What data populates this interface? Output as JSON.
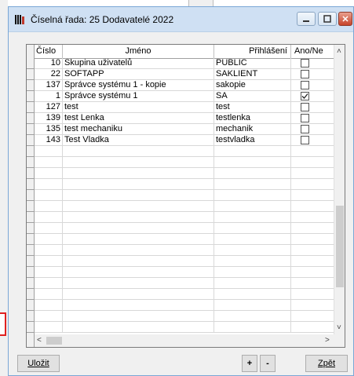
{
  "window": {
    "title": "Číselná řada: 25 Dodavatelé 2022",
    "close_glyph": "✕"
  },
  "table": {
    "columns": [
      "Číslo",
      "Jméno",
      "Přihlášení",
      "Ano/Ne"
    ],
    "rows": [
      {
        "cislo": "10",
        "jmeno": "Skupina uživatelů",
        "prihlaseni": "PUBLIC",
        "ano_ne": false
      },
      {
        "cislo": "22",
        "jmeno": "SOFTAPP",
        "prihlaseni": "SAKLIENT",
        "ano_ne": false
      },
      {
        "cislo": "137",
        "jmeno": "Správce systému 1 - kopie",
        "prihlaseni": "sakopie",
        "ano_ne": false
      },
      {
        "cislo": "1",
        "jmeno": "Správce systému 1",
        "prihlaseni": "SA",
        "ano_ne": true
      },
      {
        "cislo": "127",
        "jmeno": "test",
        "prihlaseni": "test",
        "ano_ne": false
      },
      {
        "cislo": "139",
        "jmeno": "test Lenka",
        "prihlaseni": "testlenka",
        "ano_ne": false
      },
      {
        "cislo": "135",
        "jmeno": "test mechaniku",
        "prihlaseni": "mechanik",
        "ano_ne": false
      },
      {
        "cislo": "143",
        "jmeno": "Test Vladka",
        "prihlaseni": "testvladka",
        "ano_ne": false
      }
    ]
  },
  "footer": {
    "save_label": "Uložit",
    "plus_label": "+",
    "minus_label": "-",
    "back_label": "Zpět"
  },
  "scroll": {
    "up": "˄",
    "down": "˅",
    "left": "<",
    "right": ">"
  },
  "colors": {
    "titlebar": "#cfe0f3",
    "close_button": "#c7432a",
    "highlight_border": "#e02020"
  }
}
